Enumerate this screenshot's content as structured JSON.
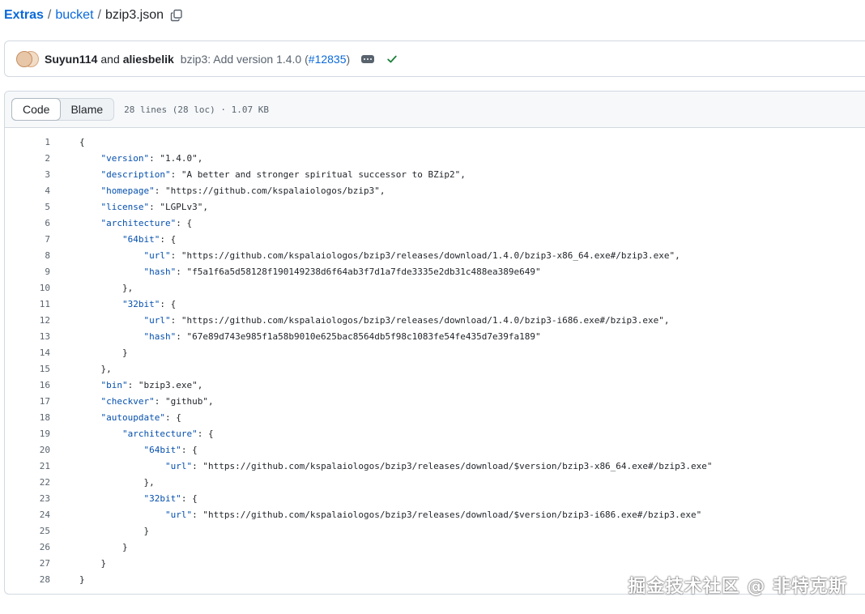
{
  "breadcrumb": {
    "repo": "Extras",
    "separator": "/",
    "folder": "bucket",
    "file": "bzip3.json"
  },
  "commit": {
    "author1": "Suyun114",
    "and": "and",
    "author2": "aliesbelik",
    "message": "bzip3: Add version 1.4.0",
    "pr_open": "(",
    "pr": "#12835",
    "pr_close": ")"
  },
  "code_view": {
    "tab_code": "Code",
    "tab_blame": "Blame",
    "meta": "28 lines (28 loc) · 1.07 KB"
  },
  "lines": [
    {
      "n": "1",
      "i": 0,
      "t": "{",
      "k": ""
    },
    {
      "n": "2",
      "i": 1,
      "k": "\"version\"",
      "t": ": \"1.4.0\","
    },
    {
      "n": "3",
      "i": 1,
      "k": "\"description\"",
      "t": ": \"A better and stronger spiritual successor to BZip2\","
    },
    {
      "n": "4",
      "i": 1,
      "k": "\"homepage\"",
      "t": ": \"https://github.com/kspalaiologos/bzip3\","
    },
    {
      "n": "5",
      "i": 1,
      "k": "\"license\"",
      "t": ": \"LGPLv3\","
    },
    {
      "n": "6",
      "i": 1,
      "k": "\"architecture\"",
      "t": ": {"
    },
    {
      "n": "7",
      "i": 2,
      "k": "\"64bit\"",
      "t": ": {"
    },
    {
      "n": "8",
      "i": 3,
      "k": "\"url\"",
      "t": ": \"https://github.com/kspalaiologos/bzip3/releases/download/1.4.0/bzip3-x86_64.exe#/bzip3.exe\","
    },
    {
      "n": "9",
      "i": 3,
      "k": "\"hash\"",
      "t": ": \"f5a1f6a5d58128f190149238d6f64ab3f7d1a7fde3335e2db31c488ea389e649\""
    },
    {
      "n": "10",
      "i": 2,
      "k": "",
      "t": "},"
    },
    {
      "n": "11",
      "i": 2,
      "k": "\"32bit\"",
      "t": ": {"
    },
    {
      "n": "12",
      "i": 3,
      "k": "\"url\"",
      "t": ": \"https://github.com/kspalaiologos/bzip3/releases/download/1.4.0/bzip3-i686.exe#/bzip3.exe\","
    },
    {
      "n": "13",
      "i": 3,
      "k": "\"hash\"",
      "t": ": \"67e89d743e985f1a58b9010e625bac8564db5f98c1083fe54fe435d7e39fa189\""
    },
    {
      "n": "14",
      "i": 2,
      "k": "",
      "t": "}"
    },
    {
      "n": "15",
      "i": 1,
      "k": "",
      "t": "},"
    },
    {
      "n": "16",
      "i": 1,
      "k": "\"bin\"",
      "t": ": \"bzip3.exe\","
    },
    {
      "n": "17",
      "i": 1,
      "k": "\"checkver\"",
      "t": ": \"github\","
    },
    {
      "n": "18",
      "i": 1,
      "k": "\"autoupdate\"",
      "t": ": {"
    },
    {
      "n": "19",
      "i": 2,
      "k": "\"architecture\"",
      "t": ": {"
    },
    {
      "n": "20",
      "i": 3,
      "k": "\"64bit\"",
      "t": ": {"
    },
    {
      "n": "21",
      "i": 4,
      "k": "\"url\"",
      "t": ": \"https://github.com/kspalaiologos/bzip3/releases/download/$version/bzip3-x86_64.exe#/bzip3.exe\""
    },
    {
      "n": "22",
      "i": 3,
      "k": "",
      "t": "},"
    },
    {
      "n": "23",
      "i": 3,
      "k": "\"32bit\"",
      "t": ": {"
    },
    {
      "n": "24",
      "i": 4,
      "k": "\"url\"",
      "t": ": \"https://github.com/kspalaiologos/bzip3/releases/download/$version/bzip3-i686.exe#/bzip3.exe\""
    },
    {
      "n": "25",
      "i": 3,
      "k": "",
      "t": "}"
    },
    {
      "n": "26",
      "i": 2,
      "k": "",
      "t": "}"
    },
    {
      "n": "27",
      "i": 1,
      "k": "",
      "t": "}"
    },
    {
      "n": "28",
      "i": 0,
      "k": "",
      "t": "}"
    }
  ],
  "watermark": "掘金技术社区 @ 非特克斯",
  "icons": {
    "copy": "copy-icon",
    "more": "kebab-horizontal-icon",
    "status": "check-icon"
  },
  "colors": {
    "link": "#0969da",
    "key": "#0550ae",
    "string": "#0a3069",
    "success": "#1a7f37",
    "border": "#d1d9e0"
  }
}
